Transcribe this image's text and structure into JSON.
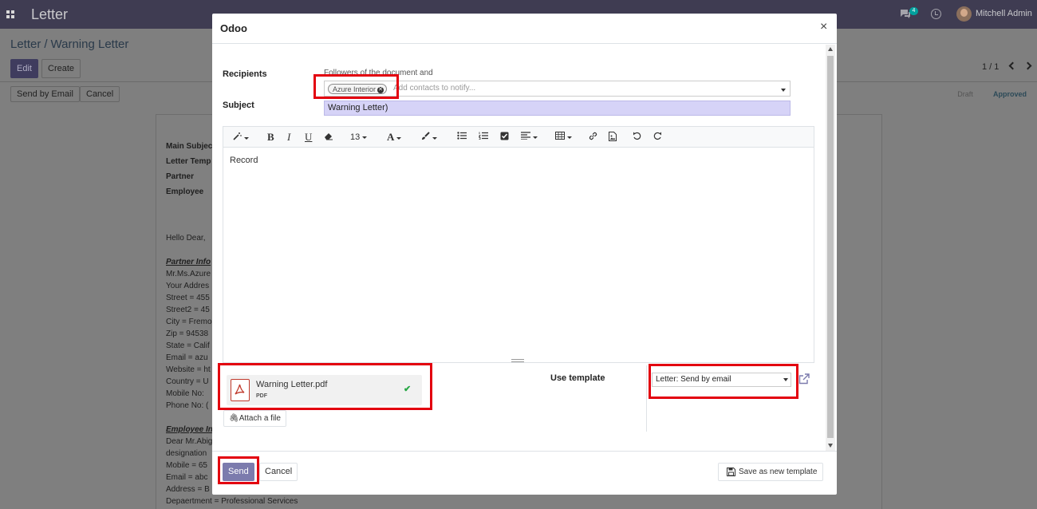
{
  "app": {
    "title": "Letter",
    "chat_count": "4",
    "user_name": "Mitchell Admin"
  },
  "breadcrumb": {
    "parent": "Letter",
    "separator": "/",
    "current": "Warning Letter"
  },
  "control_panel": {
    "edit_label": "Edit",
    "create_label": "Create",
    "pager": "1 / 1"
  },
  "statusbar": {
    "send_by_email_label": "Send by Email",
    "cancel_label": "Cancel",
    "stages": [
      "Draft",
      "Approved"
    ],
    "active_stage": "Approved"
  },
  "background_document": {
    "field_labels": [
      "Main Subjec",
      "Letter Temp",
      "Partner",
      "Employee"
    ],
    "lines": [
      "Hello Dear,",
      "",
      "Partner Info",
      "Mr.Ms.Azure",
      "Your Addres",
      "Street = 455",
      "Street2 = 45",
      "City = Fremo",
      "Zip = 94538",
      "State = Calif",
      "Email = azu",
      "Website = ht",
      "Country = U",
      "Mobile No:",
      "Phone No: (",
      "",
      "Employee In",
      "Dear Mr.Abig",
      "designation",
      "Mobile = 65",
      "Email = abc",
      "Address = B",
      "Depaertment = Professional Services"
    ]
  },
  "modal": {
    "title": "Odoo",
    "close_symbol": "×",
    "recipients_label": "Recipients",
    "followers_text": "Followers of the document and",
    "recipient_tags": [
      "Azure Interior"
    ],
    "contacts_placeholder": "Add contacts to notify...",
    "subject_label": "Subject",
    "subject_value": "Warning Letter)",
    "toolbar": {
      "font_size": "13"
    },
    "body_text": "Record",
    "attachment": {
      "name": "Warning Letter.pdf",
      "type": "PDF"
    },
    "attach_file_label": "Attach a file",
    "use_template_label": "Use template",
    "template_value": "Letter: Send by email",
    "send_label": "Send",
    "cancel_label": "Cancel",
    "save_template_label": "Save as new template"
  },
  "colors": {
    "topbar": "#3f3c52",
    "primary_button": "#7c7bad",
    "subject_highlight": "#d6d3f7",
    "annotation_red": "#e3000f",
    "success_check": "#28a745"
  }
}
